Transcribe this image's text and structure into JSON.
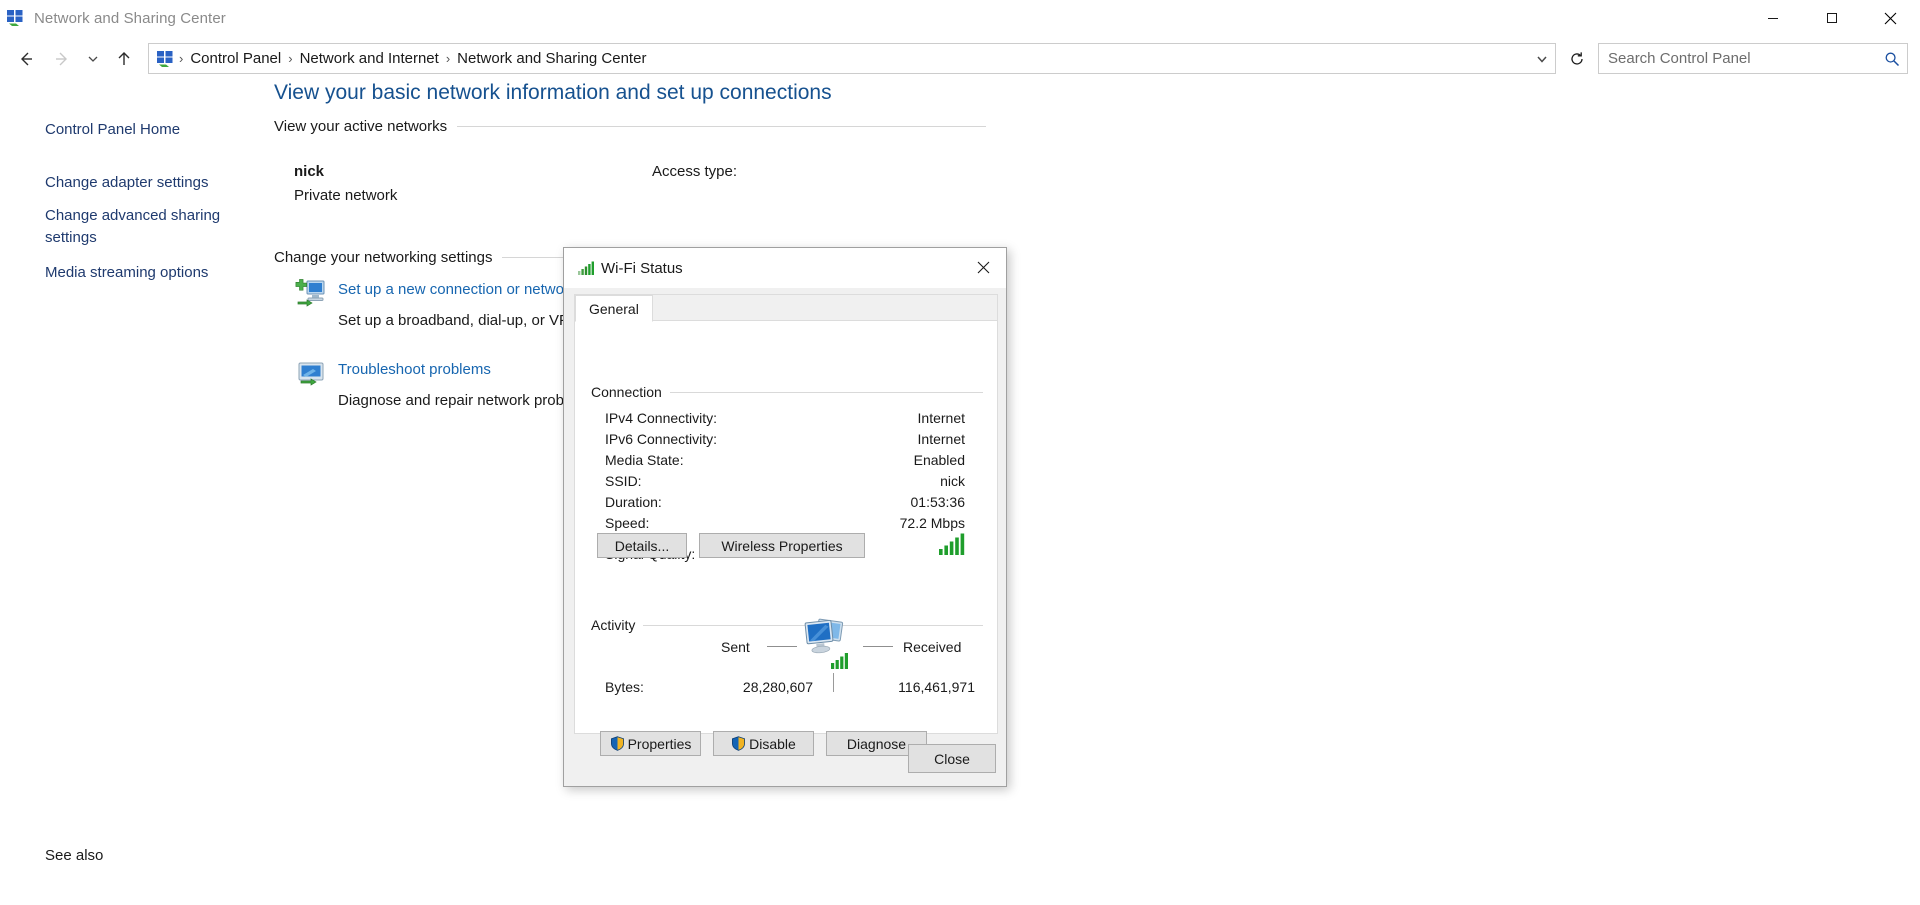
{
  "window": {
    "title": "Network and Sharing Center",
    "icon": "network-sharing-icon",
    "minimize_label": "Minimize",
    "maximize_label": "Maximize",
    "close_label": "Close"
  },
  "nav": {
    "back_label": "Back",
    "forward_label": "Forward",
    "recent_label": "Recent locations",
    "up_label": "Up",
    "refresh_label": "Refresh",
    "breadcrumbs": [
      "Control Panel",
      "Network and Internet",
      "Network and Sharing Center"
    ],
    "separator": "›"
  },
  "search": {
    "placeholder": "Search Control Panel",
    "value": "",
    "icon": "search-icon"
  },
  "sidebar": {
    "home": "Control Panel Home",
    "items": [
      "Change adapter settings",
      "Change advanced sharing settings",
      "Media streaming options"
    ],
    "see_also": "See also"
  },
  "main": {
    "page_title": "View your basic network information and set up connections",
    "section_active": "View your active networks",
    "section_change": "Change your networking settings",
    "network": {
      "name": "nick",
      "type": "Private network",
      "access_label": "Access type:"
    },
    "tasks": [
      {
        "icon": "new-connection-icon",
        "link": "Set up a new connection or network",
        "desc": "Set up a broadband, dial-up, or VPN connection; or set up a router or access point."
      },
      {
        "icon": "troubleshoot-icon",
        "link": "Troubleshoot problems",
        "desc": "Diagnose and repair network problems, or get troubleshooting information."
      }
    ]
  },
  "dialog": {
    "title": "Wi-Fi Status",
    "title_icon": "wifi-signal-icon",
    "close_icon": "close-icon",
    "tab": "General",
    "connection": {
      "group_label": "Connection",
      "rows": [
        {
          "label": "IPv4 Connectivity:",
          "value": "Internet"
        },
        {
          "label": "IPv6 Connectivity:",
          "value": "Internet"
        },
        {
          "label": "Media State:",
          "value": "Enabled"
        },
        {
          "label": "SSID:",
          "value": "nick"
        },
        {
          "label": "Duration:",
          "value": "01:53:36"
        },
        {
          "label": "Speed:",
          "value": "72.2 Mbps"
        }
      ],
      "signal_quality_label": "Signal Quality:",
      "signal_quality_bars": 5,
      "buttons": {
        "details": "Details...",
        "wireless_properties": "Wireless Properties"
      }
    },
    "activity": {
      "group_label": "Activity",
      "sent_label": "Sent",
      "received_label": "Received",
      "bytes_label": "Bytes:",
      "bytes_sent": "28,280,607",
      "bytes_received": "116,461,971",
      "computer_icon": "two-computers-icon"
    },
    "buttons": {
      "properties": "Properties",
      "disable": "Disable",
      "diagnose": "Diagnose",
      "close": "Close"
    },
    "shield_icon": "uac-shield-icon"
  },
  "colors": {
    "link": "#1766b0",
    "title_link": "#16518f",
    "sidebar_link": "#1f3a6e",
    "accent": "#0078d7",
    "signal_green": "#1f9e2c",
    "shield_blue": "#1464b4",
    "shield_gold": "#f0b323"
  }
}
